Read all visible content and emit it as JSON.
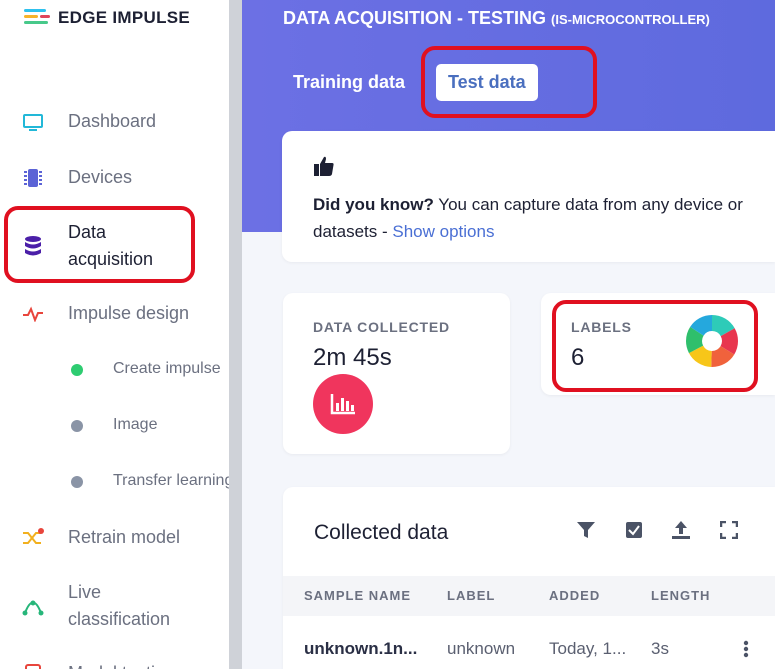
{
  "brand": {
    "name": "EDGE IMPULSE"
  },
  "sidebar": {
    "items": [
      {
        "label": "Dashboard",
        "icon": "monitor-icon"
      },
      {
        "label": "Devices",
        "icon": "chip-icon"
      },
      {
        "label": "Data acquisition",
        "icon": "database-icon",
        "active": true
      },
      {
        "label": "Impulse design",
        "icon": "pulse-icon"
      },
      {
        "label": "Retrain model",
        "icon": "shuffle-icon"
      },
      {
        "label": "Live classification",
        "icon": "tree-icon"
      },
      {
        "label": "Model testing",
        "icon": "flask-icon"
      }
    ],
    "sub_items": [
      {
        "label": "Create impulse",
        "status_color": "#2ecc71"
      },
      {
        "label": "Image",
        "status_color": "#8a94a6"
      },
      {
        "label": "Transfer learning",
        "status_color": "#8a94a6"
      }
    ]
  },
  "header": {
    "title": "DATA ACQUISITION - TESTING",
    "subtitle": "(IS-MICROCONTROLLER)",
    "tabs": [
      {
        "label": "Training data",
        "selected": false
      },
      {
        "label": "Test data",
        "selected": true
      }
    ]
  },
  "tip": {
    "icon": "thumbs-up-icon",
    "bold": "Did you know?",
    "text": " You can capture data from any device or",
    "text2": "datasets - ",
    "link": "Show options"
  },
  "stats": {
    "data_collected": {
      "label": "DATA COLLECTED",
      "value": "2m 45s",
      "icon": "bar-chart-icon"
    },
    "labels": {
      "label": "LABELS",
      "value": "6",
      "icon": "donut-chart-icon"
    }
  },
  "collected": {
    "title": "Collected data",
    "tools": [
      "filter-icon",
      "checkbox-icon",
      "upload-icon",
      "expand-icon"
    ],
    "columns": [
      "SAMPLE NAME",
      "LABEL",
      "ADDED",
      "LENGTH"
    ],
    "rows": [
      {
        "name": "unknown.1n...",
        "label": "unknown",
        "added": "Today, 1...",
        "length": "3s"
      }
    ]
  },
  "colors": {
    "accent": "#5e6ade",
    "link": "#4a6fd4",
    "annotation": "#e01020",
    "data_icon_bg": "#f0355d"
  }
}
